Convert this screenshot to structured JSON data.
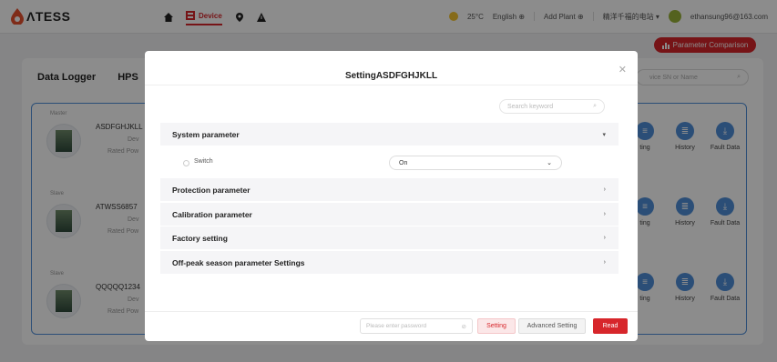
{
  "topbar": {
    "logo_text": "ΛTESS",
    "nav": [
      {
        "label": "",
        "icon": "home-icon"
      },
      {
        "label": "Device",
        "icon": "device-icon"
      },
      {
        "label": "",
        "icon": "location-icon"
      },
      {
        "label": "",
        "icon": "warning-icon"
      }
    ],
    "weather": "25°C",
    "language": "English",
    "add_plant": "Add Plant",
    "plant_select": "精洋千福的电站",
    "user_email": "ethansung96@163.com"
  },
  "param_compare_label": "Parameter Comparison",
  "panel": {
    "tabs": [
      "Data Logger",
      "HPS"
    ],
    "search_placeholder": "vice SN or Name",
    "cards": [
      {
        "tag": "Master",
        "name": "ASDFGHJKLL",
        "sub1": "Dev",
        "sub2": "Rated Pow"
      },
      {
        "tag": "Slave",
        "name": "ATWSS6857",
        "sub1": "Dev",
        "sub2": "Rated Pow"
      },
      {
        "tag": "Slave",
        "name": "QQQQQ1234",
        "sub1": "Dev",
        "sub2": "Rated Pow"
      }
    ],
    "actions": [
      {
        "label": "ting",
        "icon": "setting-icon"
      },
      {
        "label": "History",
        "icon": "history-icon"
      },
      {
        "label": "Fault Data",
        "icon": "download-icon"
      }
    ]
  },
  "modal": {
    "title": "SettingASDFGHJKLL",
    "search_placeholder": "Search keyword",
    "sections": [
      {
        "title": "System parameter",
        "expanded": true
      },
      {
        "title": "Protection parameter",
        "expanded": false
      },
      {
        "title": "Calibration parameter",
        "expanded": false
      },
      {
        "title": "Factory setting",
        "expanded": false
      },
      {
        "title": "Off-peak season parameter Settings",
        "expanded": false
      }
    ],
    "field": {
      "label": "Switch",
      "value": "On"
    },
    "password_placeholder": "Please enter password",
    "setting_btn": "Setting",
    "advanced_btn": "Advanced Setting",
    "read_btn": "Read"
  },
  "colors": {
    "accent": "#d7262b",
    "blue": "#4f8fd9"
  }
}
